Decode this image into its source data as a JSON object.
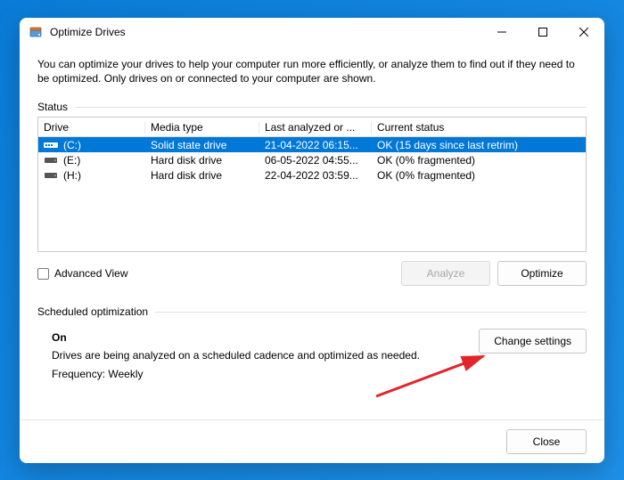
{
  "window": {
    "title": "Optimize Drives"
  },
  "intro": "You can optimize your drives to help your computer run more efficiently, or analyze them to find out if they need to be optimized. Only drives on or connected to your computer are shown.",
  "status": {
    "label": "Status",
    "columns": {
      "drive": "Drive",
      "media": "Media type",
      "last": "Last analyzed or ...",
      "current": "Current status"
    },
    "rows": [
      {
        "drive": "(C:)",
        "media": "Solid state drive",
        "last": "21-04-2022 06:15...",
        "status": "OK (15 days since last retrim)",
        "selected": true,
        "iconType": "ssd"
      },
      {
        "drive": "(E:)",
        "media": "Hard disk drive",
        "last": "06-05-2022 04:55...",
        "status": "OK (0% fragmented)",
        "selected": false,
        "iconType": "hdd"
      },
      {
        "drive": "(H:)",
        "media": "Hard disk drive",
        "last": "22-04-2022 03:59...",
        "status": "OK (0% fragmented)",
        "selected": false,
        "iconType": "hdd"
      }
    ]
  },
  "advancedView": "Advanced View",
  "buttons": {
    "analyze": "Analyze",
    "optimize": "Optimize",
    "changeSettings": "Change settings",
    "close": "Close"
  },
  "scheduled": {
    "label": "Scheduled optimization",
    "state": "On",
    "desc": "Drives are being analyzed on a scheduled cadence and optimized as needed.",
    "freq": "Frequency: Weekly"
  }
}
